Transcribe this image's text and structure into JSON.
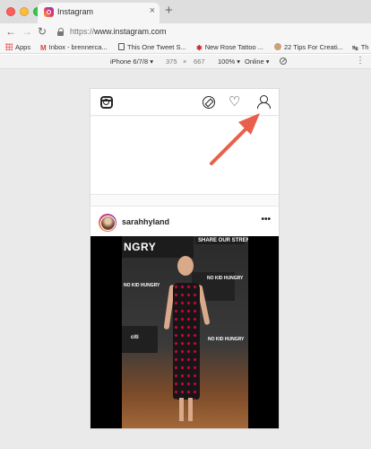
{
  "browser": {
    "tab_title": "Instagram",
    "tab_close": "×",
    "new_tab": "+",
    "url_protocol": "https://",
    "url_host": "www.instagram.com"
  },
  "bookmarks": [
    {
      "label": "Apps",
      "icon": "apps-grid-icon"
    },
    {
      "label": "Inbox - brennerca...",
      "icon": "gmail-icon"
    },
    {
      "label": "This One Tweet S...",
      "icon": "document-icon"
    },
    {
      "label": "New Rose Tattoo ...",
      "icon": "yelp-icon"
    },
    {
      "label": "22 Tips For Creati...",
      "icon": "avatar-icon"
    },
    {
      "label": "Th",
      "icon": "twitter-icon"
    }
  ],
  "device_toolbar": {
    "device": "iPhone 6/7/8 ▾",
    "width": "375",
    "times": "×",
    "height": "667",
    "zoom": "100% ▾",
    "network": "Online ▾",
    "more": "⋮"
  },
  "instagram": {
    "post_username": "sarahhyland",
    "post_more": "•••",
    "photo_text": {
      "t1": "NGRY",
      "t2": "SHARE OUR STRENGTH",
      "t3": "NO KID HUNGRY",
      "t4": "NO KID HUNGRY",
      "t5": "citi",
      "t6": "NO KID HUNGRY"
    }
  },
  "annotation": {
    "arrow_color": "#e8604c"
  }
}
